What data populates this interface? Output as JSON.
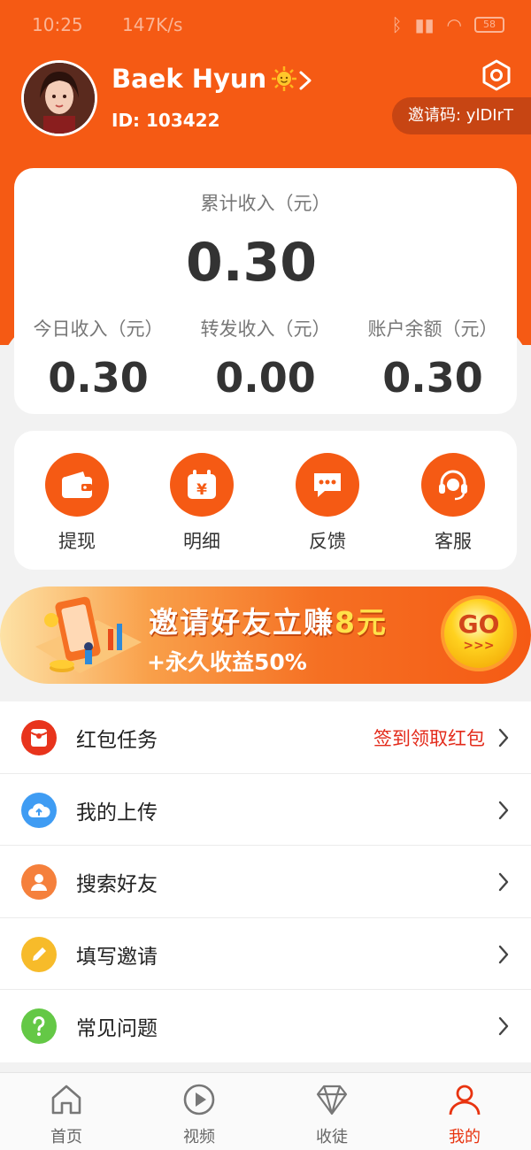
{
  "status_bar": {
    "time": "10:25",
    "speed": "147K/s",
    "battery": "58"
  },
  "profile": {
    "name": "Baek Hyun",
    "id_text": "ID: 103422",
    "invite_code": "邀请码: ylDIrT"
  },
  "income": {
    "total_label": "累计收入（元）",
    "total_value": "0.30",
    "stats": [
      {
        "label": "今日收入（元）",
        "value": "0.30"
      },
      {
        "label": "转发收入（元）",
        "value": "0.00"
      },
      {
        "label": "账户余额（元）",
        "value": "0.30"
      }
    ]
  },
  "actions": [
    {
      "label": "提现",
      "icon": "wallet-icon"
    },
    {
      "label": "明细",
      "icon": "calendar-yen-icon"
    },
    {
      "label": "反馈",
      "icon": "chat-bubble-icon"
    },
    {
      "label": "客服",
      "icon": "headset-icon"
    }
  ],
  "banner": {
    "title_prefix": "邀请好友立赚",
    "title_highlight": "8元",
    "subtitle": "+永久收益50%",
    "go_label": "GO",
    "go_arrows": ">>>"
  },
  "menu": [
    {
      "label": "红包任务",
      "extra": "签到领取红包",
      "icon": "red-envelope-icon",
      "color": "#e8341c"
    },
    {
      "label": "我的上传",
      "extra": "",
      "icon": "cloud-upload-icon",
      "color": "#3f9cf3"
    },
    {
      "label": "搜索好友",
      "extra": "",
      "icon": "user-icon",
      "color": "#f5803c"
    },
    {
      "label": "填写邀请",
      "extra": "",
      "icon": "pencil-icon",
      "color": "#f7bb2a"
    },
    {
      "label": "常见问题",
      "extra": "",
      "icon": "question-icon",
      "color": "#64c846"
    }
  ],
  "tabs": [
    {
      "label": "首页",
      "icon": "home-icon",
      "active": false
    },
    {
      "label": "视频",
      "icon": "play-icon",
      "active": false
    },
    {
      "label": "收徒",
      "icon": "diamond-icon",
      "active": false
    },
    {
      "label": "我的",
      "icon": "person-icon",
      "active": true
    }
  ],
  "colors": {
    "accent": "#f55a14",
    "active_tab": "#e8330f",
    "highlight_red": "#e32b1b"
  }
}
